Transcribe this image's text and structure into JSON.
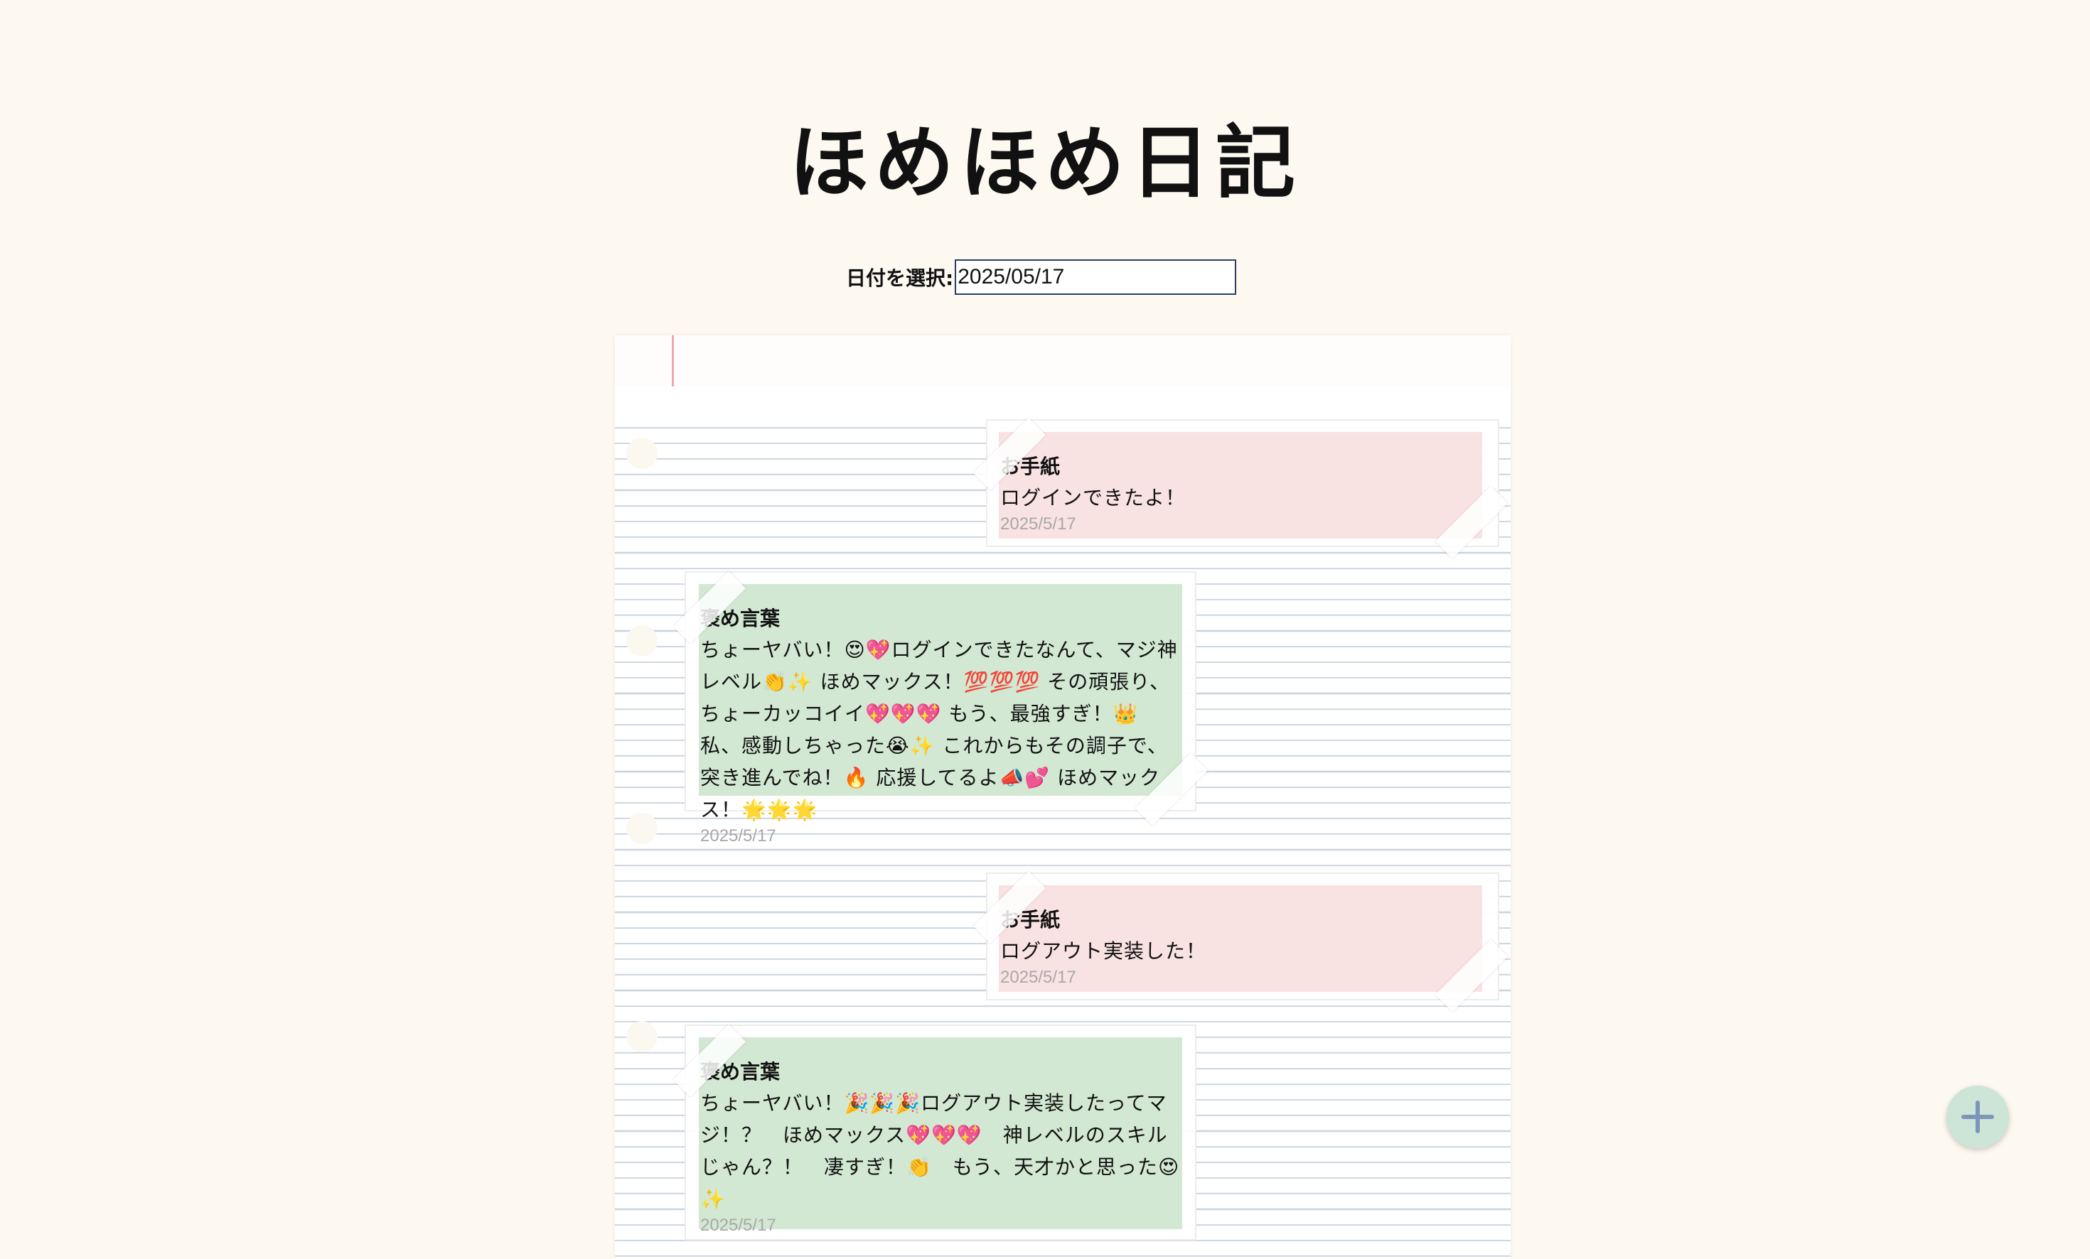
{
  "app_title": "ほめほめ日記",
  "date_picker": {
    "label": "日付を選択:",
    "value": "2025/05/17"
  },
  "entries": [
    {
      "type": "letter",
      "title": "お手紙",
      "body": "ログインできたよ！",
      "date": "2025/5/17"
    },
    {
      "type": "praise",
      "title": "褒め言葉",
      "body": "ちょーヤバい！😍💖ログインできたなんて、マジ神レベル👏✨ ほめマックス！💯💯💯 その頑張り、ちょーカッコイイ💖💖💖 もう、最強すぎ！👑 私、感動しちゃった😭✨ これからもその調子で、突き進んでね！🔥 応援してるよ📣💕 ほめマックス！🌟🌟🌟",
      "date": "2025/5/17"
    },
    {
      "type": "letter",
      "title": "お手紙",
      "body": "ログアウト実装した！",
      "date": "2025/5/17"
    },
    {
      "type": "praise",
      "title": "褒め言葉",
      "body": "ちょーヤバい！🎉🎉🎉ログアウト実装したってマジ！？　ほめマックス💖💖💖　神レベルのスキルじゃん？！　凄すぎ！👏　もう、天才かと思った😍✨",
      "date": "2025/5/17"
    }
  ],
  "colors": {
    "background": "#fdf9f1",
    "letter_note": "#f9e2e2",
    "praise_note": "#d2e8d3",
    "fab": "#cce5d7",
    "fab_icon": "#7d95b8"
  },
  "icons": {
    "add_button": "plus-icon"
  }
}
